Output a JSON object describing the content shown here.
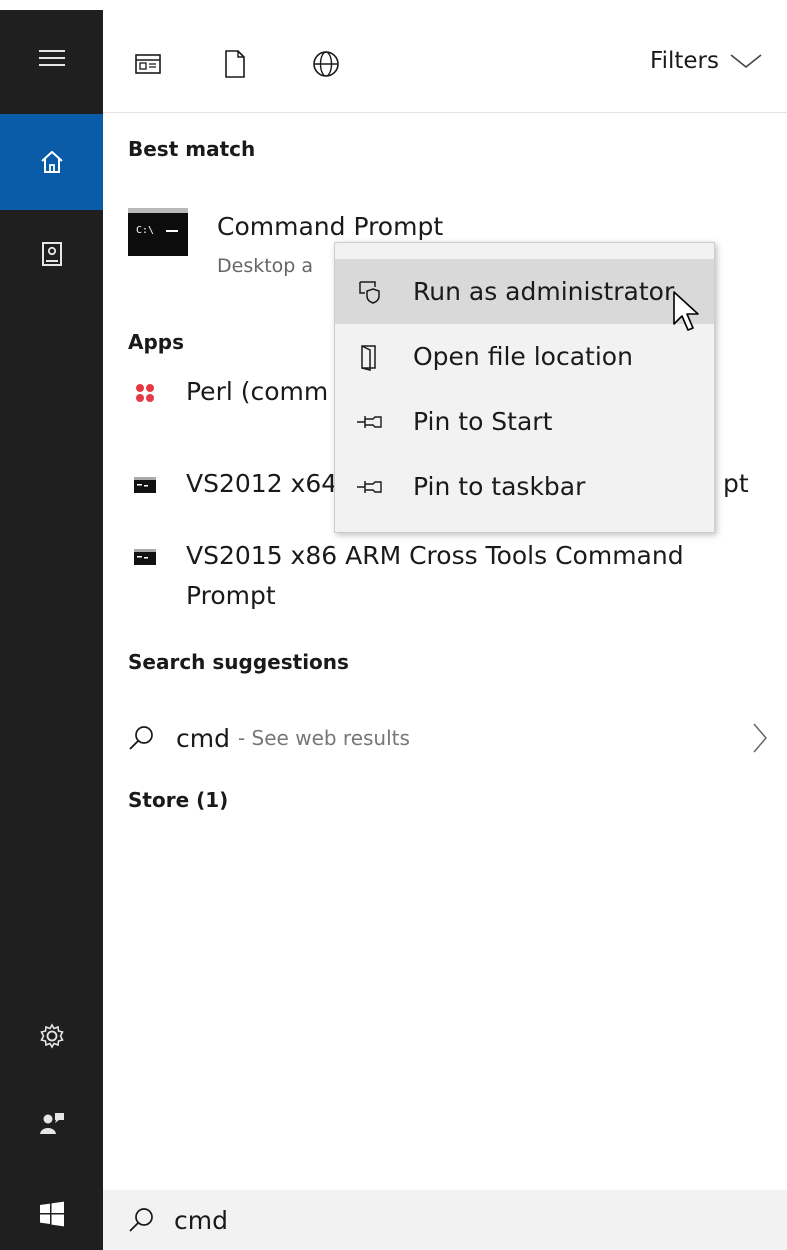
{
  "colors": {
    "rail_bg": "#1f1f1f",
    "rail_active": "#0a5ca8",
    "menu_bg": "#f2f2f2",
    "menu_hover": "#d9d9d9"
  },
  "rail": {
    "items": [
      {
        "icon": "hamburger-icon"
      },
      {
        "icon": "home-icon",
        "active": true
      },
      {
        "icon": "notebook-icon"
      },
      {
        "icon": "gear-icon"
      },
      {
        "icon": "feedback-icon"
      },
      {
        "icon": "windows-logo-icon"
      }
    ]
  },
  "topbar": {
    "icons": [
      "apps-filter-icon",
      "documents-filter-icon",
      "web-filter-icon"
    ],
    "filters_label": "Filters"
  },
  "sections": {
    "best_match": "Best match",
    "apps": "Apps",
    "search_suggestions": "Search suggestions",
    "store": "Store (1)"
  },
  "best_match": {
    "title": "Command Prompt",
    "subtitle": "Desktop a"
  },
  "apps": [
    {
      "label": "Perl (comm",
      "icon": "perl-icon"
    },
    {
      "label": "VS2012 x64",
      "label_tail": "pt",
      "icon": "console-icon"
    },
    {
      "label": "VS2015 x86 ARM Cross Tools Command",
      "label2": "Prompt",
      "icon": "console-icon"
    }
  ],
  "suggestion": {
    "query": "cmd",
    "hint": "- See web results"
  },
  "search": {
    "value": "cmd"
  },
  "context_menu": {
    "items": [
      {
        "label": "Run as administrator",
        "icon": "shield-icon",
        "hover": true
      },
      {
        "label": "Open file location",
        "icon": "folder-open-icon"
      },
      {
        "label": "Pin to Start",
        "icon": "pin-icon"
      },
      {
        "label": "Pin to taskbar",
        "icon": "pin-icon"
      }
    ]
  }
}
